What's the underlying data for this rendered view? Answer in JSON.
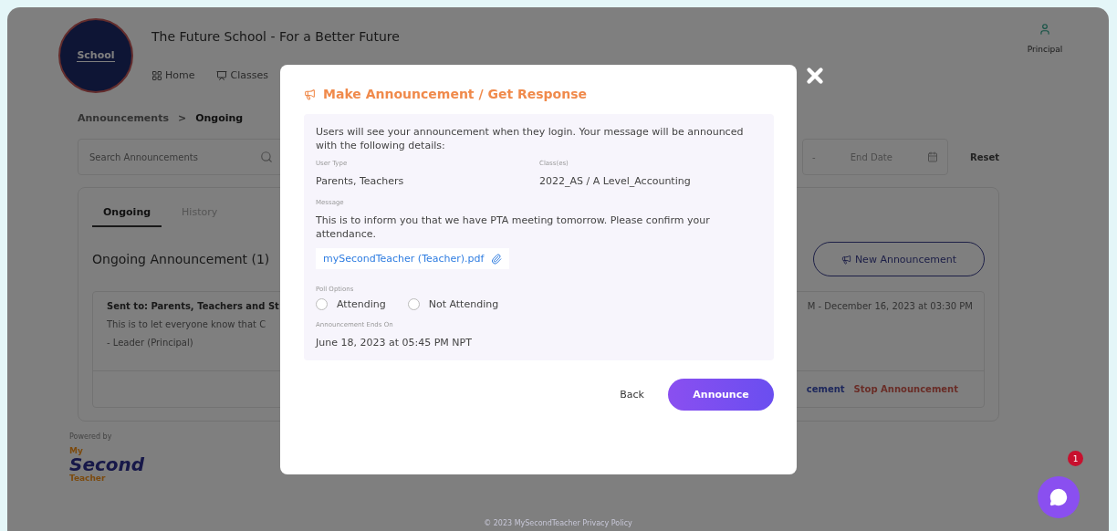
{
  "header": {
    "logo_text": "School",
    "school_name": "The Future School - For a Better Future",
    "nav": [
      {
        "label": "Home",
        "kind": "home"
      },
      {
        "label": "Classes",
        "kind": "classes"
      }
    ],
    "user_role": "Principal"
  },
  "breadcrumb": {
    "items": [
      "Announcements",
      "Ongoing"
    ],
    "separator": ">"
  },
  "filters": {
    "search_placeholder": "Search Announcements",
    "date_separator": "-",
    "end_date_placeholder": "End Date",
    "reset": "Reset"
  },
  "tabs": [
    {
      "label": "Ongoing",
      "selected": true
    },
    {
      "label": "History",
      "selected": false
    }
  ],
  "section_title": "Ongoing Announcement (1)",
  "new_button": "New Announcement",
  "announcement": {
    "sent_to": "Sent to: Parents, Teachers and St",
    "body": "This is to let everyone know that C",
    "author": "- Leader (Principal)",
    "date_range": "M - December 16, 2023 at 03:30 PM",
    "actions": [
      {
        "label": "cement",
        "kind": "edit"
      },
      {
        "label": "Stop Announcement",
        "kind": "stop"
      }
    ]
  },
  "footer": {
    "powered_by": "Powered by",
    "logo": [
      "My",
      "Second",
      "Teacher"
    ],
    "copyright": "© 2023 MySecondTeacher Privacy Policy"
  },
  "chat": {
    "badge": "1"
  },
  "modal": {
    "title": "Make Announcement / Get Response",
    "intro": "Users will see your announcement when they login. Your message will be announced with the following details:",
    "user_type_label": "User Type",
    "user_type": "Parents, Teachers",
    "classes_label": "Class(es)",
    "classes": "2022_AS / A Level_Accounting",
    "message_label": "Message",
    "message": "This is to inform you that we have PTA meeting tomorrow. Please confirm your attendance.",
    "attachment": "mySecondTeacher (Teacher).pdf",
    "poll_label": "Poll Options",
    "poll_options": [
      {
        "label": "Attending",
        "selected": false
      },
      {
        "label": "Not Attending",
        "selected": false
      }
    ],
    "ends_label": "Announcement Ends On",
    "ends": "June 18, 2023 at 05:45 PM NPT",
    "back": "Back",
    "announce": "Announce"
  }
}
